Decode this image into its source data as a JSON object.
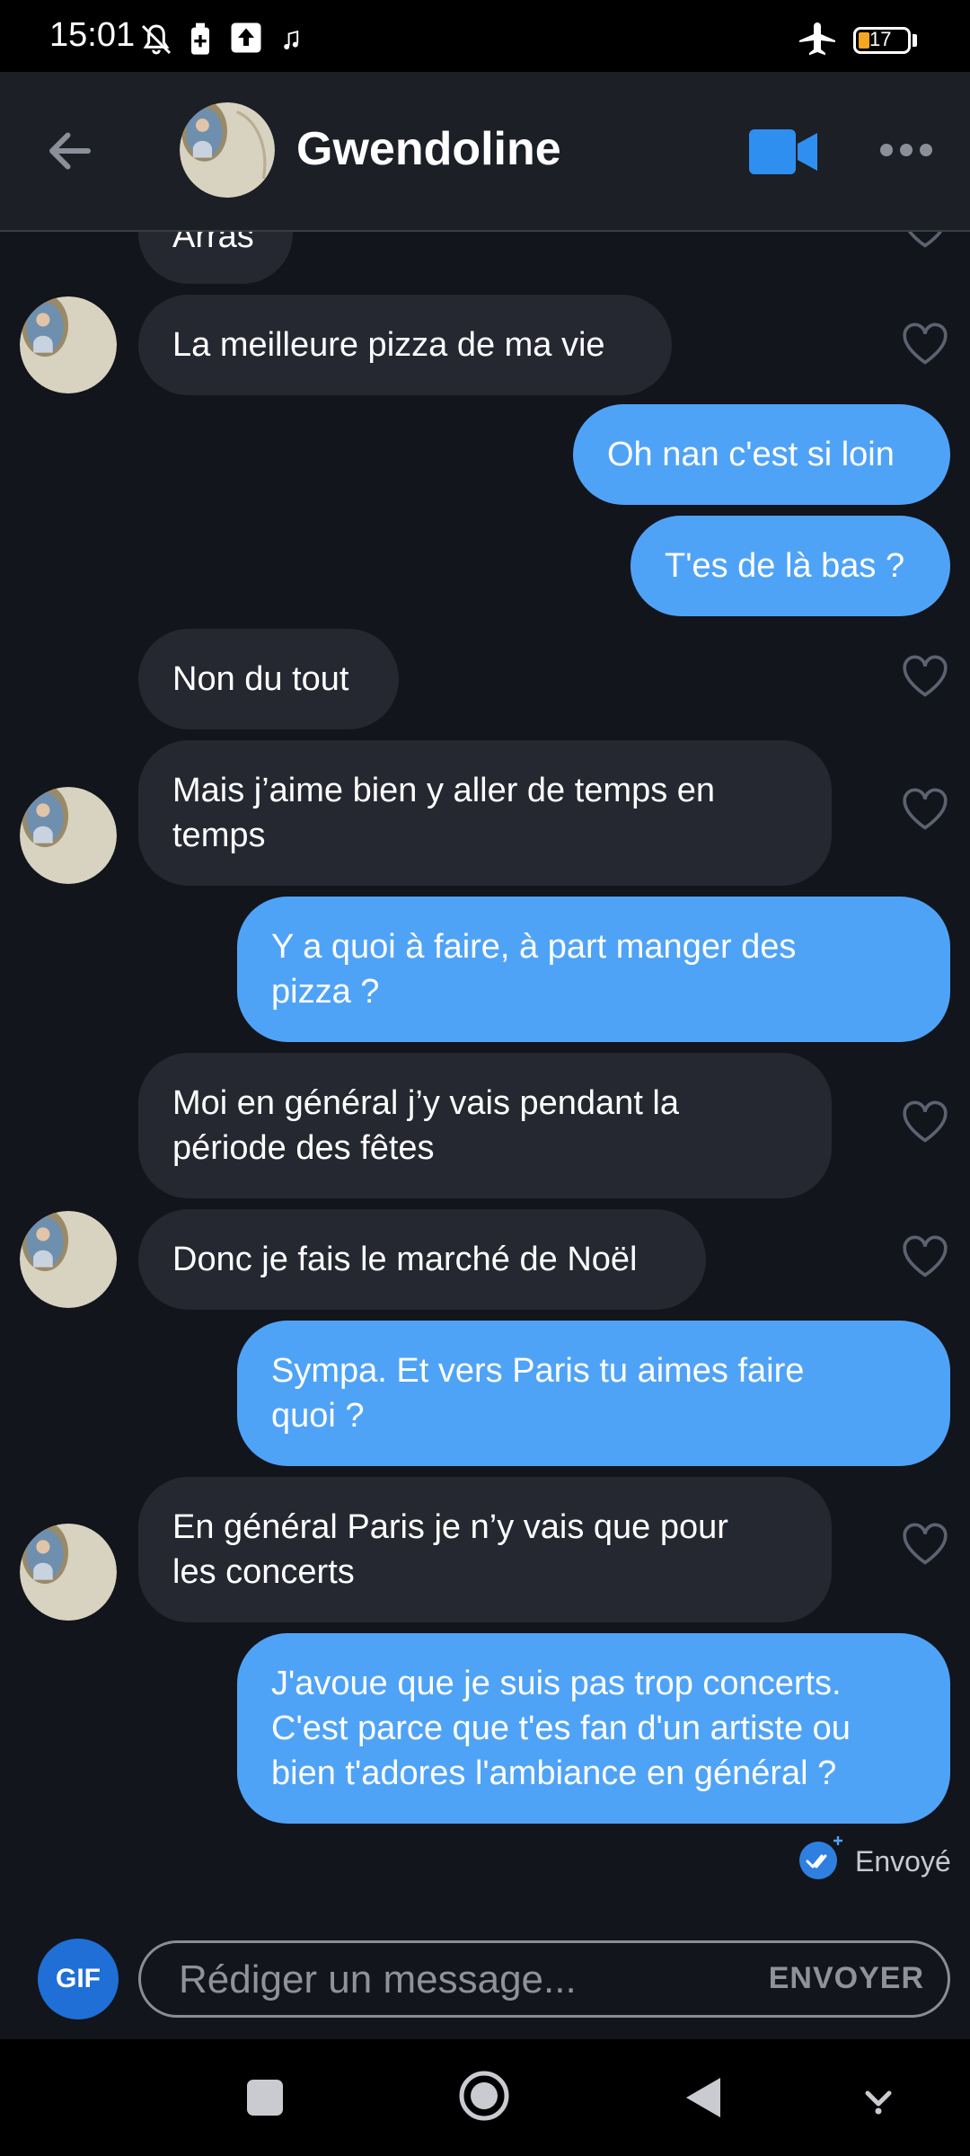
{
  "status_bar": {
    "time": "15:01",
    "battery_level": "17",
    "icons": [
      "bell-off-icon",
      "battery-saver-icon",
      "upload-icon",
      "music-note-icon",
      "airplane-icon",
      "battery-icon"
    ]
  },
  "header": {
    "contact_name": "Gwendoline",
    "back_icon": "arrow-left-icon",
    "video_icon": "video-camera-icon",
    "more_icon": "more-dots-icon"
  },
  "messages": [
    {
      "id": "m0",
      "side": "received",
      "text": "Arras"
    },
    {
      "id": "m1",
      "side": "received",
      "text": "La meilleure pizza de ma vie"
    },
    {
      "id": "m2",
      "side": "sent",
      "text": "Oh nan c'est si loin"
    },
    {
      "id": "m3",
      "side": "sent",
      "text": "T'es de là bas ?"
    },
    {
      "id": "m4",
      "side": "received",
      "text": "Non du tout"
    },
    {
      "id": "m5",
      "side": "received",
      "lines": [
        "Mais j’aime bien y aller de temps en",
        "temps"
      ]
    },
    {
      "id": "m6",
      "side": "sent",
      "lines": [
        "Y a quoi à faire, à part manger des",
        "pizza ?"
      ]
    },
    {
      "id": "m7",
      "side": "received",
      "lines": [
        "Moi en général j’y vais pendant la",
        "période des fêtes"
      ]
    },
    {
      "id": "m8",
      "side": "received",
      "text": "Donc je fais le marché de Noël"
    },
    {
      "id": "m9",
      "side": "sent",
      "lines": [
        "Sympa. Et vers Paris tu aimes faire",
        "quoi ?"
      ]
    },
    {
      "id": "m10",
      "side": "received",
      "lines": [
        "En général Paris je n’y vais que pour",
        "les concerts"
      ]
    },
    {
      "id": "m11",
      "side": "sent",
      "lines": [
        "J'avoue que je suis pas trop concerts.",
        "C'est parce que t'es fan d'un artiste ou",
        "bien t'adores l'ambiance en général ?"
      ]
    }
  ],
  "sent_status": "Envoyé",
  "composer": {
    "gif_label": "GIF",
    "placeholder": "Rédiger un message...",
    "send_label": "ENVOYER"
  },
  "navbar": {
    "icons": [
      "recents-square-icon",
      "home-circle-icon",
      "back-triangle-icon",
      "keyboard-hide-icon"
    ]
  },
  "colors": {
    "background": "#12151c",
    "received_bubble": "#252830",
    "sent_bubble": "#4fa3f7",
    "accent": "#1f6fd6"
  }
}
